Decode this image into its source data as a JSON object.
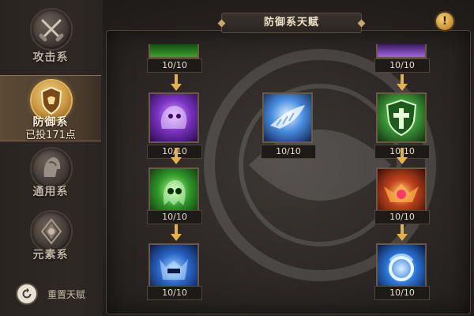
{
  "sidebar": {
    "items": [
      {
        "label": "攻击系",
        "icon": "crossed-swords-icon",
        "active": false
      },
      {
        "label": "防御系",
        "sub": "已投171点",
        "icon": "shield-icon",
        "active": true
      },
      {
        "label": "通用系",
        "icon": "helmet-icon",
        "active": false
      },
      {
        "label": "元素系",
        "icon": "diamond-crystal-icon",
        "active": false
      }
    ],
    "reset_label": "重置天赋"
  },
  "header": {
    "title": "防御系天赋",
    "info_icon": "exclamation-icon"
  },
  "talents": {
    "col1_top_cut": {
      "count": "10/10",
      "icon": "green-rune-icon"
    },
    "col3_top_cut": {
      "count": "10/10",
      "icon": "purple-rune-icon"
    },
    "purple_demon": {
      "count": "10/10",
      "icon": "purple-demon-icon"
    },
    "angel_wing": {
      "count": "10/10",
      "icon": "angel-wing-icon"
    },
    "green_shield": {
      "count": "10/10",
      "icon": "green-shield-cross-icon"
    },
    "green_ghost": {
      "count": "10/10",
      "icon": "green-ghost-icon"
    },
    "fire_crest": {
      "count": "10/10",
      "icon": "fire-crest-icon"
    },
    "blue_helm": {
      "count": "10/10",
      "icon": "blue-horned-helm-icon"
    },
    "blue_orb": {
      "count": "10/10",
      "icon": "blue-orb-icon"
    }
  },
  "colors": {
    "accent_gold": "#e4b24a",
    "panel_bg": "#2c2724",
    "active_tab": "#5c4a36"
  }
}
